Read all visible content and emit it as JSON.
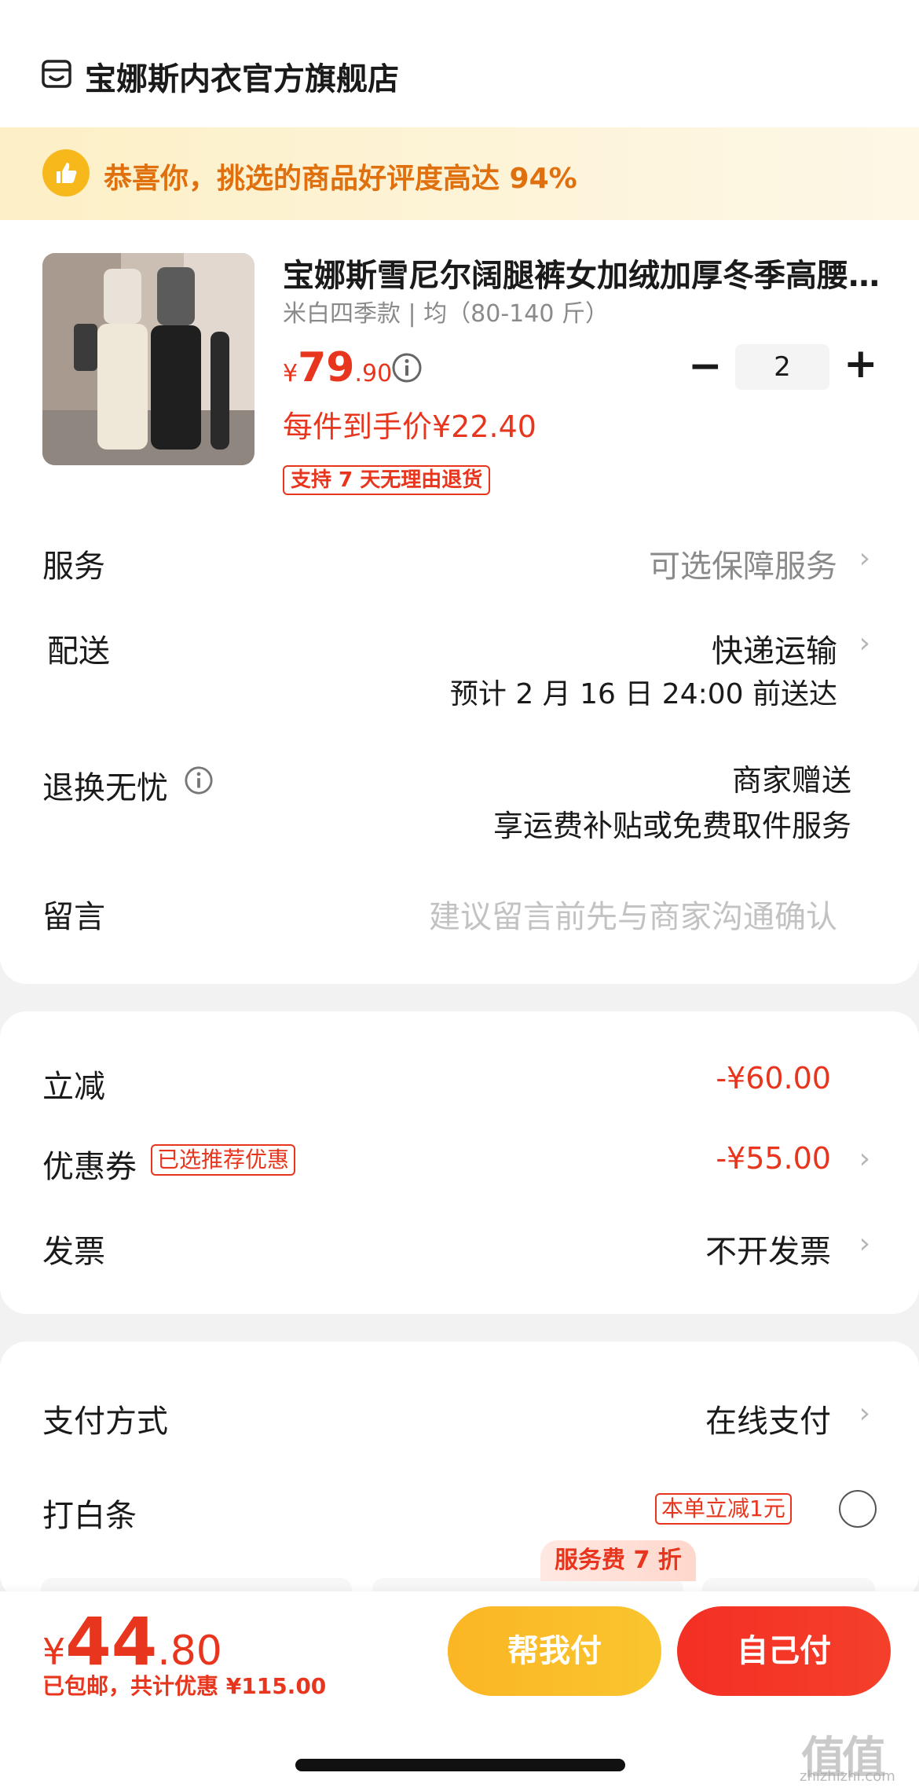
{
  "store": {
    "name": "宝娜斯内衣官方旗舰店"
  },
  "banner": {
    "text": "恭喜你，挑选的商品好评度高达 94%"
  },
  "product": {
    "title": "宝娜斯雪尼尔阔腿裤女加绒加厚冬季高腰…",
    "spec": "米白四季款 | 均（80-140 斤）",
    "price_currency": "¥",
    "price_int": "79",
    "price_dec": ".90",
    "unit_price": "每件到手价¥22.40",
    "return_tag": "支持 7 天无理由退货",
    "quantity": "2",
    "minus": "−",
    "plus": "+"
  },
  "rows": {
    "service": {
      "label": "服务",
      "value": "可选保障服务"
    },
    "delivery": {
      "label": "配送",
      "value": "快递运输",
      "eta": "预计 2 月 16 日 24:00 前送达"
    },
    "returns": {
      "label": "退换无忧",
      "value": "商家赠送",
      "sub": "享运费补贴或免费取件服务"
    },
    "message": {
      "label": "留言",
      "placeholder": "建议留言前先与商家沟通确认"
    }
  },
  "discounts": {
    "reduce": {
      "label": "立减",
      "value": "-¥60.00"
    },
    "coupon": {
      "label": "优惠券",
      "tag": "已选推荐优惠",
      "value": "-¥55.00"
    },
    "invoice": {
      "label": "发票",
      "value": "不开发票"
    }
  },
  "payment": {
    "method": {
      "label": "支付方式",
      "value": "在线支付"
    },
    "baitiao": {
      "label": "打白条",
      "tag": "本单立减1元"
    },
    "installment_badge": "服务费 7 折"
  },
  "footer": {
    "total_currency": "¥",
    "total_int": "44",
    "total_dec": ".80",
    "total_note": "已包邮，共计优惠 ¥115.00",
    "help_pay": "帮我付",
    "self_pay": "自己付"
  },
  "watermark": {
    "main": "值值值",
    "url": "zhizhizhi.com"
  },
  "chevron": "›",
  "colors": {
    "accent": "#e8361e",
    "banner_text": "#e0700e",
    "help_pay": "#fbb624",
    "self_pay": "#f42f24"
  }
}
